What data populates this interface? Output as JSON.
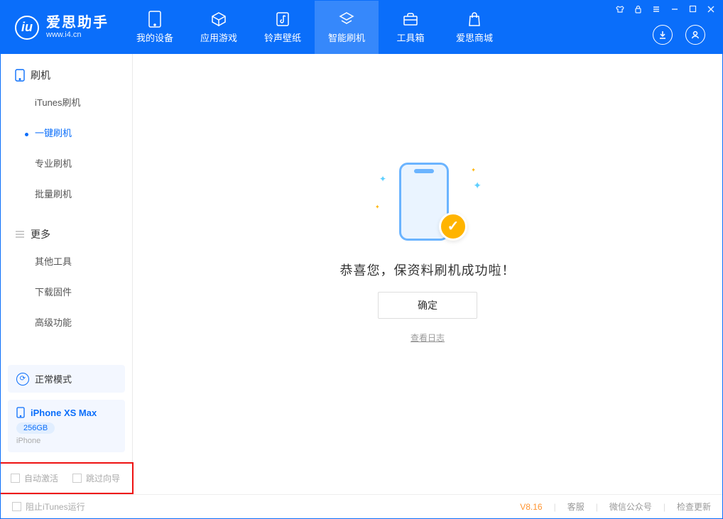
{
  "app": {
    "logo_glyph": "iu",
    "title": "爱思助手",
    "subtitle": "www.i4.cn"
  },
  "nav": {
    "items": [
      {
        "label": "我的设备"
      },
      {
        "label": "应用游戏"
      },
      {
        "label": "铃声壁纸"
      },
      {
        "label": "智能刷机"
      },
      {
        "label": "工具箱"
      },
      {
        "label": "爱思商城"
      }
    ]
  },
  "sidebar": {
    "section1": {
      "title": "刷机",
      "items": [
        {
          "label": "iTunes刷机"
        },
        {
          "label": "一键刷机",
          "active": true
        },
        {
          "label": "专业刷机"
        },
        {
          "label": "批量刷机"
        }
      ]
    },
    "section2": {
      "title": "更多",
      "items": [
        {
          "label": "其他工具"
        },
        {
          "label": "下载固件"
        },
        {
          "label": "高级功能"
        }
      ]
    },
    "mode": {
      "label": "正常模式"
    },
    "device": {
      "name": "iPhone XS Max",
      "storage": "256GB",
      "type": "iPhone"
    },
    "options": {
      "auto_activate": "自动激活",
      "skip_wizard": "跳过向导"
    }
  },
  "main": {
    "success_msg": "恭喜您，保资料刷机成功啦！",
    "confirm_btn": "确定",
    "log_link": "查看日志"
  },
  "footer": {
    "block_itunes": "阻止iTunes运行",
    "version": "V8.16",
    "links": {
      "support": "客服",
      "wechat": "微信公众号",
      "update": "检查更新"
    }
  }
}
